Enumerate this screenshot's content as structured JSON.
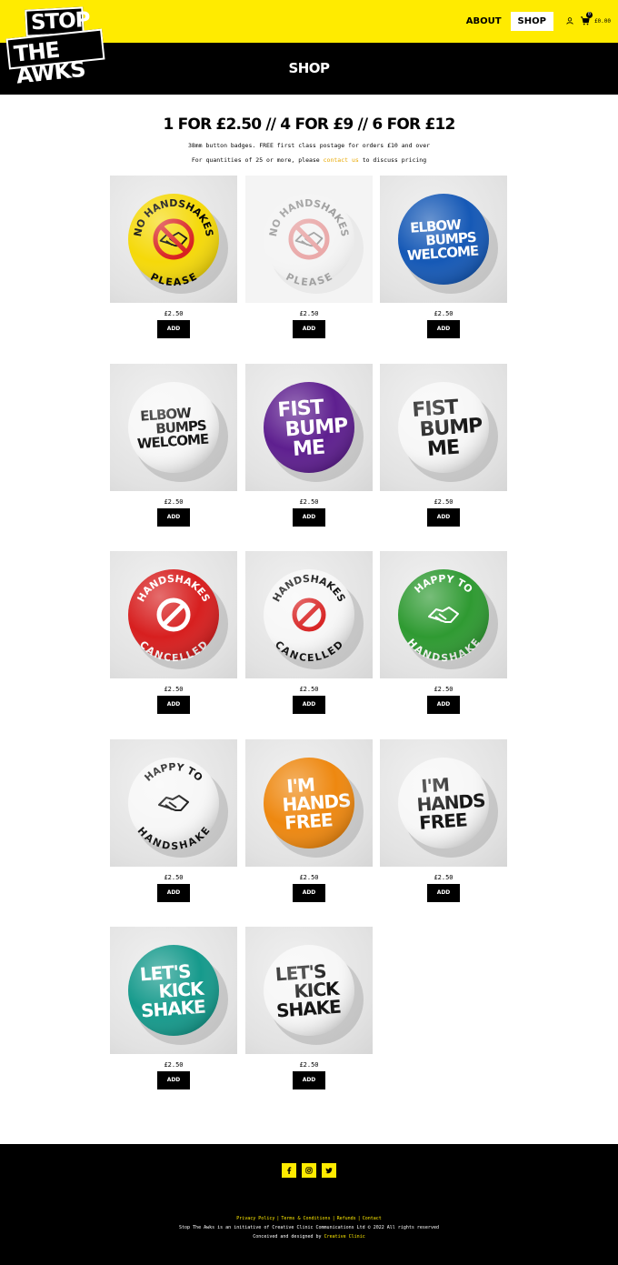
{
  "brand": {
    "line1": "STOP",
    "line2": "THE AWKS"
  },
  "nav": {
    "items": [
      {
        "label": "ABOUT",
        "active": false
      },
      {
        "label": "SHOP",
        "active": true
      }
    ],
    "cart_count": "0",
    "cart_total": "£0.00"
  },
  "page": {
    "title": "SHOP"
  },
  "intro": {
    "headline": "1 FOR £2.50 // 4 FOR £9 // 6 FOR £12",
    "line1": "38mm button badges. FREE first class postage for orders £10 and over",
    "line2_before": "For quantities of 25 or more, please ",
    "line2_link": "contact us",
    "line2_after": " to discuss pricing"
  },
  "products": [
    {
      "design": "no-handshakes",
      "badge_text": [
        "NO HANDSHAKES",
        "PLEASE"
      ],
      "badge_color": "#f5d90a",
      "text_color": "#000000",
      "icon_color": "#d82020",
      "faded": false,
      "price": "£2.50",
      "button": "ADD"
    },
    {
      "design": "no-handshakes",
      "badge_text": [
        "NO HANDSHAKES",
        "PLEASE"
      ],
      "badge_color": "#f7f7f7",
      "text_color": "#000000",
      "icon_color": "#d82020",
      "faded": true,
      "price": "£2.50",
      "button": "ADD"
    },
    {
      "design": "elbow-bumps",
      "badge_text": [
        "ELBOW",
        "BUMPS",
        "WELCOME"
      ],
      "badge_color": "#1659b6",
      "text_color": "#ffffff",
      "icon_color": "",
      "faded": false,
      "price": "£2.50",
      "button": "ADD"
    },
    {
      "design": "elbow-bumps",
      "badge_text": [
        "ELBOW",
        "BUMPS",
        "WELCOME"
      ],
      "badge_color": "#f7f7f7",
      "text_color": "#111111",
      "icon_color": "",
      "faded": false,
      "price": "£2.50",
      "button": "ADD"
    },
    {
      "design": "fist-bump",
      "badge_text": [
        "FIST",
        "BUMP",
        "ME"
      ],
      "badge_color": "#5e1f8f",
      "text_color": "#ffffff",
      "icon_color": "",
      "faded": false,
      "price": "£2.50",
      "button": "ADD"
    },
    {
      "design": "fist-bump",
      "badge_text": [
        "FIST",
        "BUMP",
        "ME"
      ],
      "badge_color": "#f7f7f7",
      "text_color": "#111111",
      "icon_color": "",
      "faded": false,
      "price": "£2.50",
      "button": "ADD"
    },
    {
      "design": "cancelled",
      "badge_text": [
        "HANDSHAKES",
        "CANCELLED"
      ],
      "badge_color": "#d71f1f",
      "text_color": "#ffffff",
      "icon_color": "#ffffff",
      "faded": false,
      "price": "£2.50",
      "button": "ADD"
    },
    {
      "design": "cancelled",
      "badge_text": [
        "HANDSHAKES",
        "CANCELLED"
      ],
      "badge_color": "#f7f7f7",
      "text_color": "#111111",
      "icon_color": "#d71f1f",
      "faded": false,
      "price": "£2.50",
      "button": "ADD"
    },
    {
      "design": "happy-to",
      "badge_text": [
        "HAPPY TO",
        "HANDSHAKE"
      ],
      "badge_color": "#2f9a32",
      "text_color": "#ffffff",
      "icon_color": "#ffffff",
      "faded": false,
      "price": "£2.50",
      "button": "ADD"
    },
    {
      "design": "happy-to",
      "badge_text": [
        "HAPPY TO",
        "HANDSHAKE"
      ],
      "badge_color": "#f7f7f7",
      "text_color": "#111111",
      "icon_color": "#111111",
      "faded": false,
      "price": "£2.50",
      "button": "ADD"
    },
    {
      "design": "hands-free",
      "badge_text": [
        "I'M",
        "HANDS",
        "FREE"
      ],
      "badge_color": "#ee8810",
      "text_color": "#ffffff",
      "icon_color": "",
      "faded": false,
      "price": "£2.50",
      "button": "ADD"
    },
    {
      "design": "hands-free",
      "badge_text": [
        "I'M",
        "HANDS",
        "FREE"
      ],
      "badge_color": "#f7f7f7",
      "text_color": "#111111",
      "icon_color": "",
      "faded": false,
      "price": "£2.50",
      "button": "ADD"
    },
    {
      "design": "kick-shake",
      "badge_text": [
        "LET'S",
        "KICK",
        "SHAKE"
      ],
      "badge_color": "#169a8c",
      "text_color": "#ffffff",
      "icon_color": "",
      "faded": false,
      "price": "£2.50",
      "button": "ADD"
    },
    {
      "design": "kick-shake",
      "badge_text": [
        "LET'S",
        "KICK",
        "SHAKE"
      ],
      "badge_color": "#f7f7f7",
      "text_color": "#111111",
      "icon_color": "",
      "faded": false,
      "price": "£2.50",
      "button": "ADD"
    }
  ],
  "footer": {
    "social": [
      "facebook-icon",
      "instagram-icon",
      "twitter-icon"
    ],
    "links": [
      "Privacy Policy",
      "Terms & Conditions",
      "Refunds",
      "Contact"
    ],
    "line1": "Stop The Awks is an initiative of Creative Clinic Communications Ltd © 2022 All rights reserved",
    "line2_before": "Conceived and designed by ",
    "line2_link": "Creative Clinic"
  }
}
